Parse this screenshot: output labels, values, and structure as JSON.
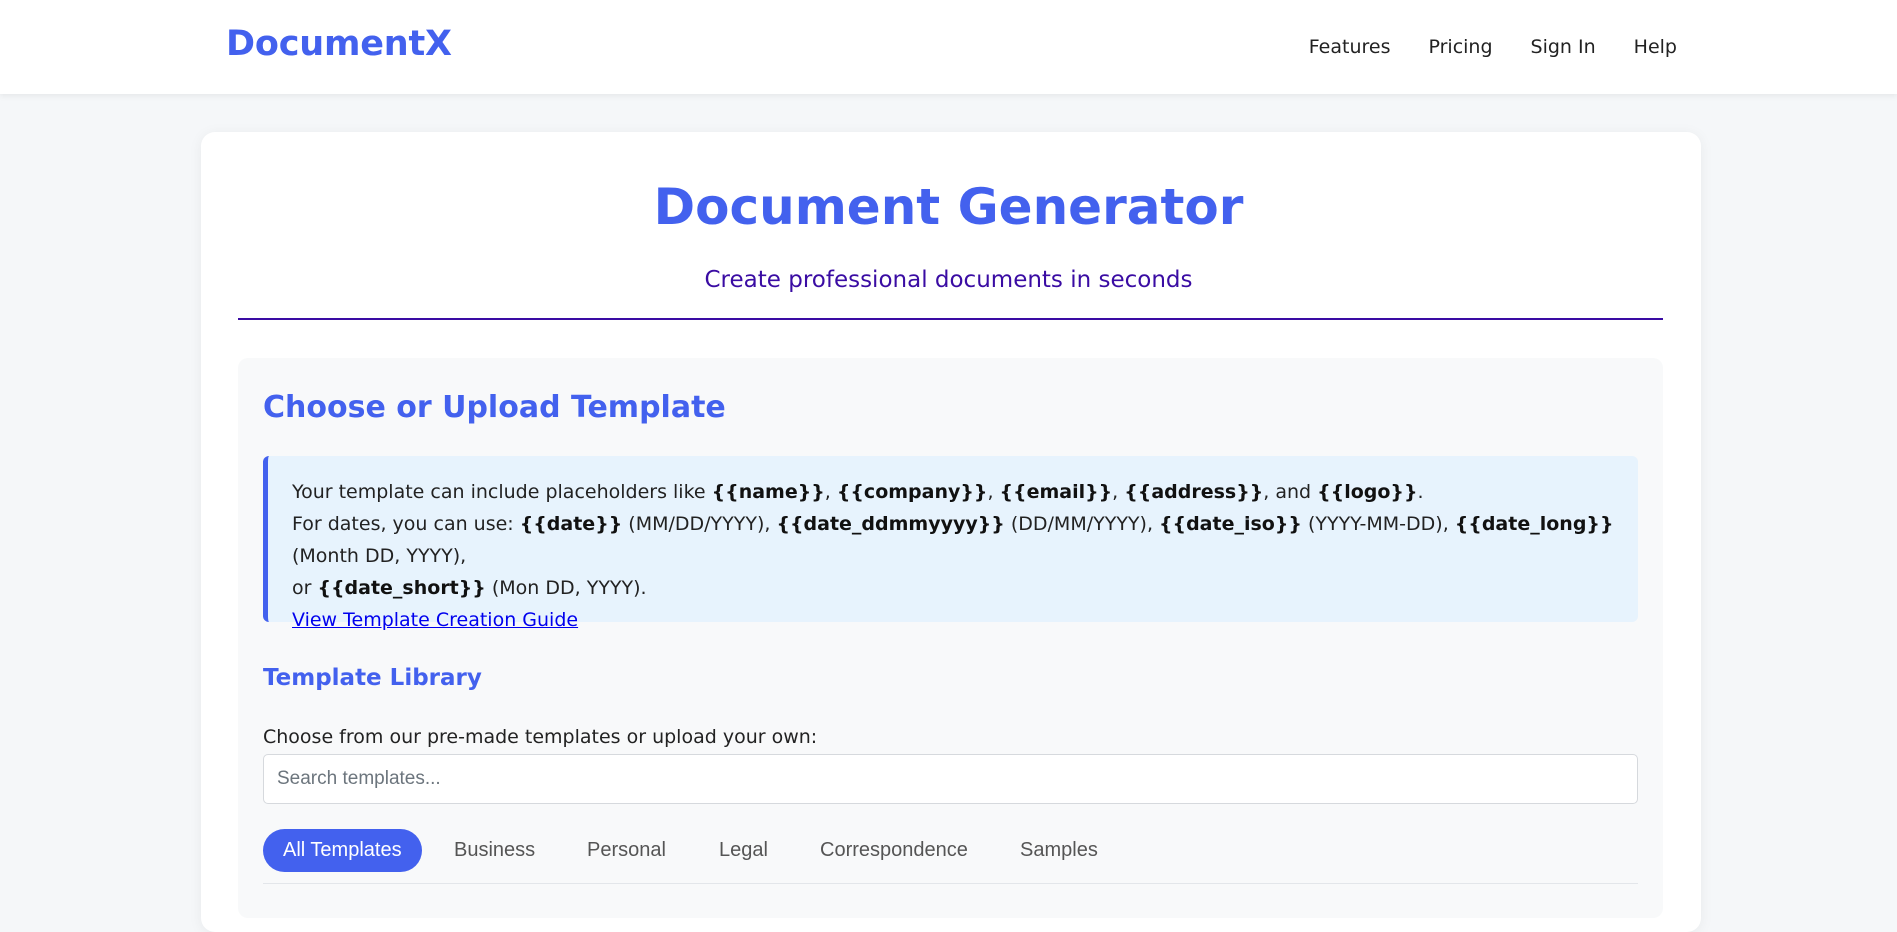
{
  "header": {
    "brand": "DocumentX",
    "nav": [
      {
        "label": "Features"
      },
      {
        "label": "Pricing"
      },
      {
        "label": "Sign In"
      },
      {
        "label": "Help"
      }
    ]
  },
  "hero": {
    "title": "Document Generator",
    "subtitle": "Create professional documents in seconds"
  },
  "template_section": {
    "heading": "Choose or Upload Template",
    "info": {
      "line1_prefix": "Your template can include placeholders like ",
      "ph_name": "{{name}}",
      "sep1": ", ",
      "ph_company": "{{company}}",
      "sep2": ", ",
      "ph_email": "{{email}}",
      "sep3": ", ",
      "ph_address": "{{address}}",
      "sep4": ", and ",
      "ph_logo": "{{logo}}",
      "line1_end": ".",
      "line2_prefix": "For dates, you can use: ",
      "ph_date": "{{date}}",
      "fmt_date": " (MM/DD/YYYY), ",
      "ph_date_ddmmyyyy": "{{date_ddmmyyyy}}",
      "fmt_ddmmyyyy": " (DD/MM/YYYY), ",
      "ph_date_iso": "{{date_iso}}",
      "fmt_iso": " (YYYY-MM-DD), ",
      "ph_date_long": "{{date_long}}",
      "fmt_long": " (Month DD, YYYY),",
      "line3_prefix": "or ",
      "ph_date_short": "{{date_short}}",
      "fmt_short": " (Mon DD, YYYY).",
      "guide_link": "View Template Creation Guide"
    },
    "library": {
      "heading": "Template Library",
      "choose_label": "Choose from our pre-made templates or upload your own:",
      "search_placeholder": "Search templates...",
      "tabs": [
        {
          "label": "All Templates",
          "active": true
        },
        {
          "label": "Business",
          "active": false
        },
        {
          "label": "Personal",
          "active": false
        },
        {
          "label": "Legal",
          "active": false
        },
        {
          "label": "Correspondence",
          "active": false
        },
        {
          "label": "Samples",
          "active": false
        }
      ]
    }
  },
  "colors": {
    "brand": "#4361ee",
    "accent_dark": "#3a0ca3",
    "info_bg": "#e7f3fd",
    "link": "#0000ee"
  }
}
